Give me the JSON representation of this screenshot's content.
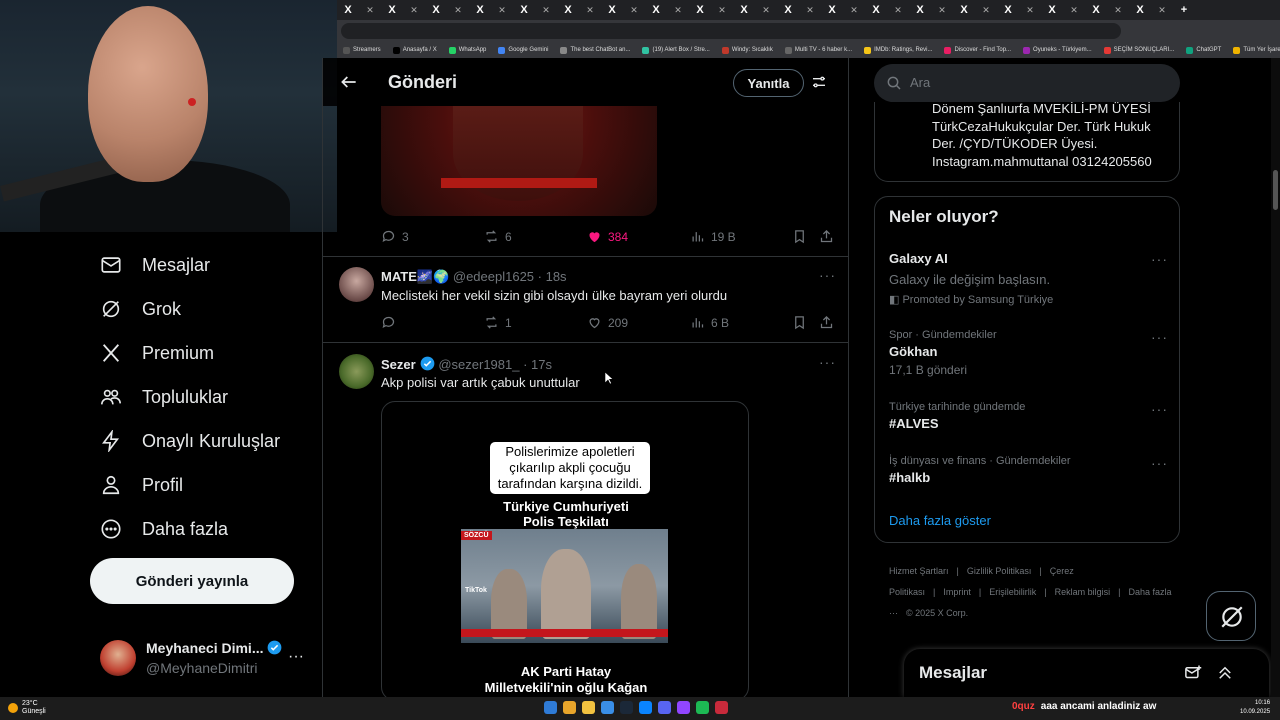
{
  "tabstrip": {
    "new_tab_label": "+"
  },
  "bookmarks": [
    {
      "label": "Streamers",
      "color": "#555555"
    },
    {
      "label": "Anasayfa / X",
      "color": "#000000"
    },
    {
      "label": "WhatsApp",
      "color": "#25d366"
    },
    {
      "label": "Google Gemini",
      "color": "#4285f4"
    },
    {
      "label": "The best ChatBot an...",
      "color": "#888888"
    },
    {
      "label": "(19) Alert Box / Stre...",
      "color": "#31c3a2"
    },
    {
      "label": "Windy: Sıcaklık",
      "color": "#c0392b"
    },
    {
      "label": "Multi TV - 6 haber k...",
      "color": "#666666"
    },
    {
      "label": "IMDb: Ratings, Revi...",
      "color": "#f5c518"
    },
    {
      "label": "Discover - Find Top...",
      "color": "#e91e63"
    },
    {
      "label": "Oyuneks - Türkiyem...",
      "color": "#9c27b0"
    },
    {
      "label": "SEÇİM SONUÇLARI...",
      "color": "#e53935"
    },
    {
      "label": "ChatGPT",
      "color": "#10a37f"
    },
    {
      "label": "Tüm Yer İşaretleri",
      "color": "#f0b400"
    }
  ],
  "nav": {
    "items": [
      {
        "label": "Mesajlar",
        "icon": "mail-icon"
      },
      {
        "label": "Grok",
        "icon": "grok-icon"
      },
      {
        "label": "Premium",
        "icon": "x-logo-icon"
      },
      {
        "label": "Topluluklar",
        "icon": "people-icon"
      },
      {
        "label": "Onaylı Kuruluşlar",
        "icon": "lightning-icon"
      },
      {
        "label": "Profil",
        "icon": "person-icon"
      },
      {
        "label": "Daha fazla",
        "icon": "more-circle-icon"
      }
    ],
    "post_button": "Gönderi yayınla",
    "account": {
      "name": "Meyhaneci Dimi...",
      "handle": "@MeyhaneDimitri",
      "more": "···"
    }
  },
  "header": {
    "title": "Gönderi",
    "reply_button": "Yanıtla"
  },
  "post_actions": {
    "replies": "3",
    "reposts": "6",
    "likes": "384",
    "views": "19 B",
    "like_color": "#f91880"
  },
  "tweets": [
    {
      "name": "MATE🌌🌍",
      "handle": "@edeepl1625",
      "time": "· 18s",
      "text": "Meclisteki her vekil sizin gibi olsaydı ülke bayram yeri olurdu",
      "replies": "",
      "reposts": "1",
      "likes": "209",
      "views": "6 B"
    },
    {
      "name": "Sezer",
      "handle": "@sezer1981_",
      "time": "· 17s",
      "text": "Akp polisi var artık çabuk unuttular"
    }
  ],
  "video": {
    "caption": "Polislerimize apoletleri çıkarılıp akpli çocuğu tarafından karşına dizildi.",
    "sub_line1": "Türkiye Cumhuriyeti",
    "sub_line2": "Polis Teşkilatı",
    "watermark": "TikTok",
    "source_tag": "SÖZCÜ",
    "bottom_line1": "AK Parti Hatay",
    "bottom_line2": "Milletvekili'nin oğlu Kağan"
  },
  "search": {
    "placeholder": "Ara"
  },
  "bio": {
    "text": "Dönem Şanlıurfa MVEKİLİ-PM ÜYESİ TürkCezaHukukçular Der. Türk Hukuk Der. /ÇYD/TÜKODER Üyesi. Instagram.mahmuttanal 03124205560"
  },
  "trends": {
    "title": "Neler oluyor?",
    "items": [
      {
        "category": "",
        "title": "Galaxy AI",
        "sub": "Galaxy ile değişim başlasın.",
        "promo": "Promoted by Samsung Türkiye"
      },
      {
        "category": "Spor · Gündemdekiler",
        "title": "Gökhan",
        "sub": "17,1 B gönderi"
      },
      {
        "category": "Türkiye tarihinde gündemde",
        "title": "#ALVES",
        "sub": ""
      },
      {
        "category": "İş dünyası ve finans · Gündemdekiler",
        "title": "#halkb",
        "sub": ""
      }
    ],
    "show_more": "Daha fazla göster"
  },
  "footer": {
    "links": [
      "Hizmet Şartları",
      "|",
      "Gizlilik Politikası",
      "|",
      "Çerez Politikası",
      "|",
      "Imprint",
      "|",
      "Erişilebilirlik",
      "|",
      "Reklam bilgisi",
      "|",
      "Daha fazla ···",
      "© 2025 X Corp."
    ]
  },
  "dm": {
    "title": "Mesajlar"
  },
  "taskbar": {
    "temp": "23°C",
    "weather": "Güneşli",
    "ticker_user": "0quz",
    "ticker_msg": "aaa ancami anladiniz aw",
    "time": "10:16",
    "date": "10.09.2025"
  }
}
